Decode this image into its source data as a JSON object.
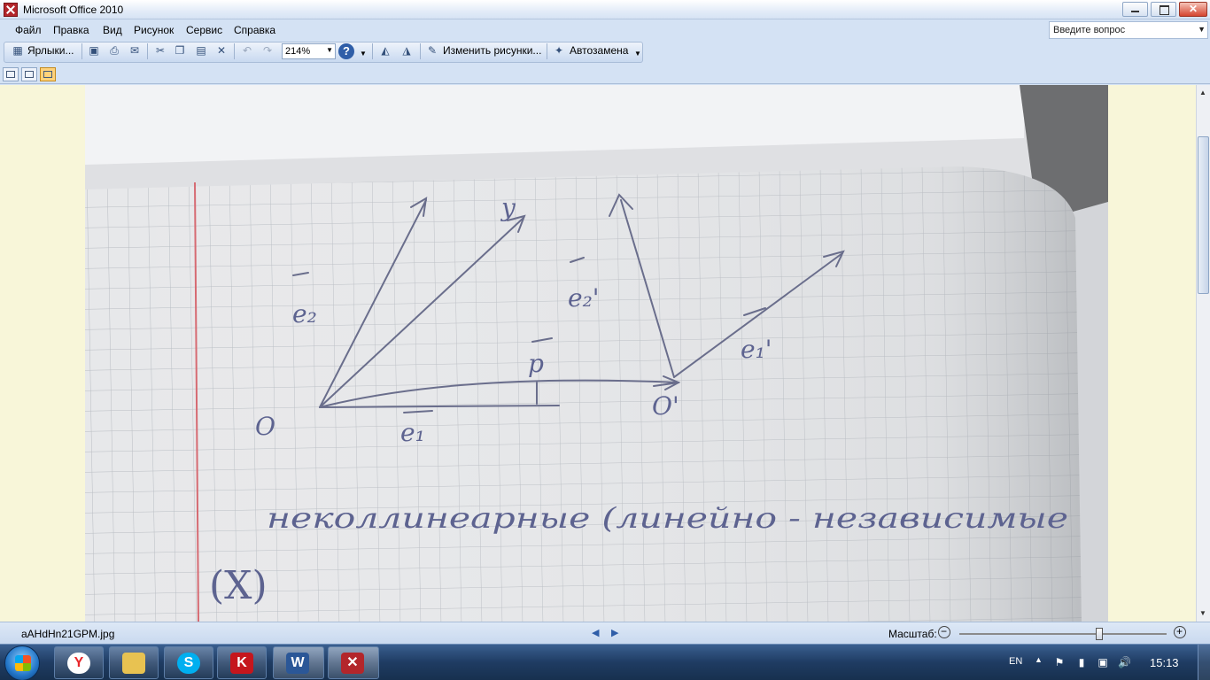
{
  "window": {
    "title": "Microsoft Office 2010"
  },
  "menu": {
    "items": [
      "Файл",
      "Правка",
      "Вид",
      "Рисунок",
      "Сервис",
      "Справка"
    ],
    "help_placeholder": "Введите вопрос"
  },
  "toolbar": {
    "shortcuts_label": "Ярлыки...",
    "zoom_value": "214%",
    "edit_pictures_label": "Изменить рисунки...",
    "autocorrect_label": "Автозамена"
  },
  "photo": {
    "labels": {
      "y": "y",
      "e2": "e₂",
      "e2_prime": "e₂'",
      "e1": "e₁",
      "e1_prime": "e₁'",
      "p": "p",
      "o": "O",
      "o_prime": "O'"
    },
    "handwritten_line": "неколлинеарные (линейно - независимые",
    "handwritten_bottom": "(X)"
  },
  "status": {
    "filename": "aAHdHn21GPM.jpg",
    "zoom_label": "Масштаб:",
    "zoom_level": 0.68
  },
  "taskbar": {
    "language": "EN",
    "clock": "15:13"
  },
  "colors": {
    "title_bg": "#dbe6f5",
    "viewer_bg": "#f8f6d9",
    "ink": "#5a6aa8",
    "accent_office": "#b3262b"
  }
}
